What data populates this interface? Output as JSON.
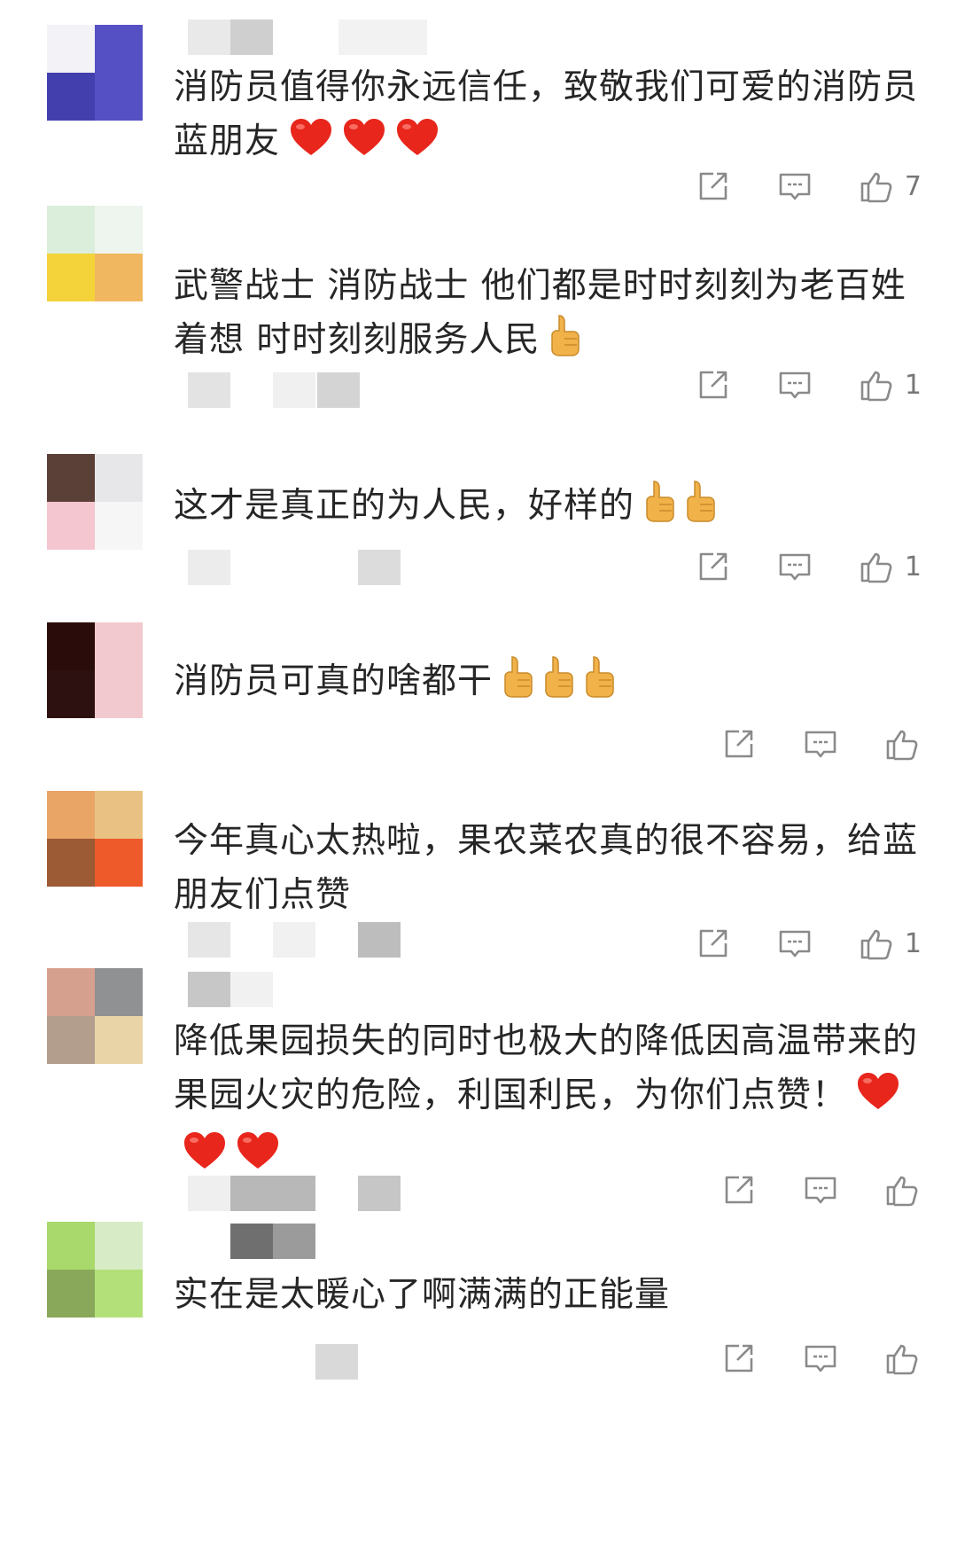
{
  "comments": [
    {
      "avatar": [
        "#f3f3f7",
        "#5550c4",
        "#4340ad",
        "#5550c4"
      ],
      "text": "消防员值得你永远信任，致敬我们可爱的消防员蓝朋友",
      "emoji": [
        "heart",
        "heart",
        "heart"
      ],
      "likes": "7"
    },
    {
      "avatar": [
        "#dbeedb",
        "#eef4ee",
        "#f4d23a",
        "#f0b760"
      ],
      "text": "武警战士 消防战士 他们都是时时刻刻为老百姓着想 时时刻刻服务人民",
      "emoji": [
        "thumb"
      ],
      "likes": "1"
    },
    {
      "avatar": [
        "#5b4038",
        "#e7e7e9",
        "#f4c6cf",
        "#f6f6f6"
      ],
      "text": "这才是真正的为人民，好样的",
      "emoji": [
        "thumb",
        "thumb"
      ],
      "likes": "1"
    },
    {
      "avatar": [
        "#2a0d0a",
        "#f2c9ce",
        "#2d1110",
        "#f2c9ce"
      ],
      "text": "消防员可真的啥都干",
      "emoji": [
        "thumb",
        "thumb",
        "thumb"
      ],
      "likes": ""
    },
    {
      "avatar": [
        "#e8a566",
        "#e9c283",
        "#9c5a35",
        "#ef5a2a"
      ],
      "text": "今年真心太热啦，果农菜农真的很不容易，给蓝朋友们点赞",
      "emoji": [],
      "likes": "1"
    },
    {
      "avatar": [
        "#d6a08e",
        "#8f9192",
        "#b39e8d",
        "#e8d4a6"
      ],
      "text": "降低果园损失的同时也极大的降低因高温带来的果园火灾的危险，利国利民，为你们点赞！",
      "emoji": [
        "heart",
        "heart",
        "heart"
      ],
      "likes": ""
    },
    {
      "avatar": [
        "#a9d86c",
        "#d7ecc6",
        "#8aa85a",
        "#b4e07a"
      ],
      "text": "实在是太暖心了啊满满的正能量",
      "emoji": [],
      "likes": ""
    }
  ],
  "colors": {
    "icon": "#8a8a8a",
    "heart": "#e8261c",
    "thumb": "#f1b24a"
  },
  "icons": [
    "share-icon",
    "reply-icon",
    "like-icon"
  ]
}
